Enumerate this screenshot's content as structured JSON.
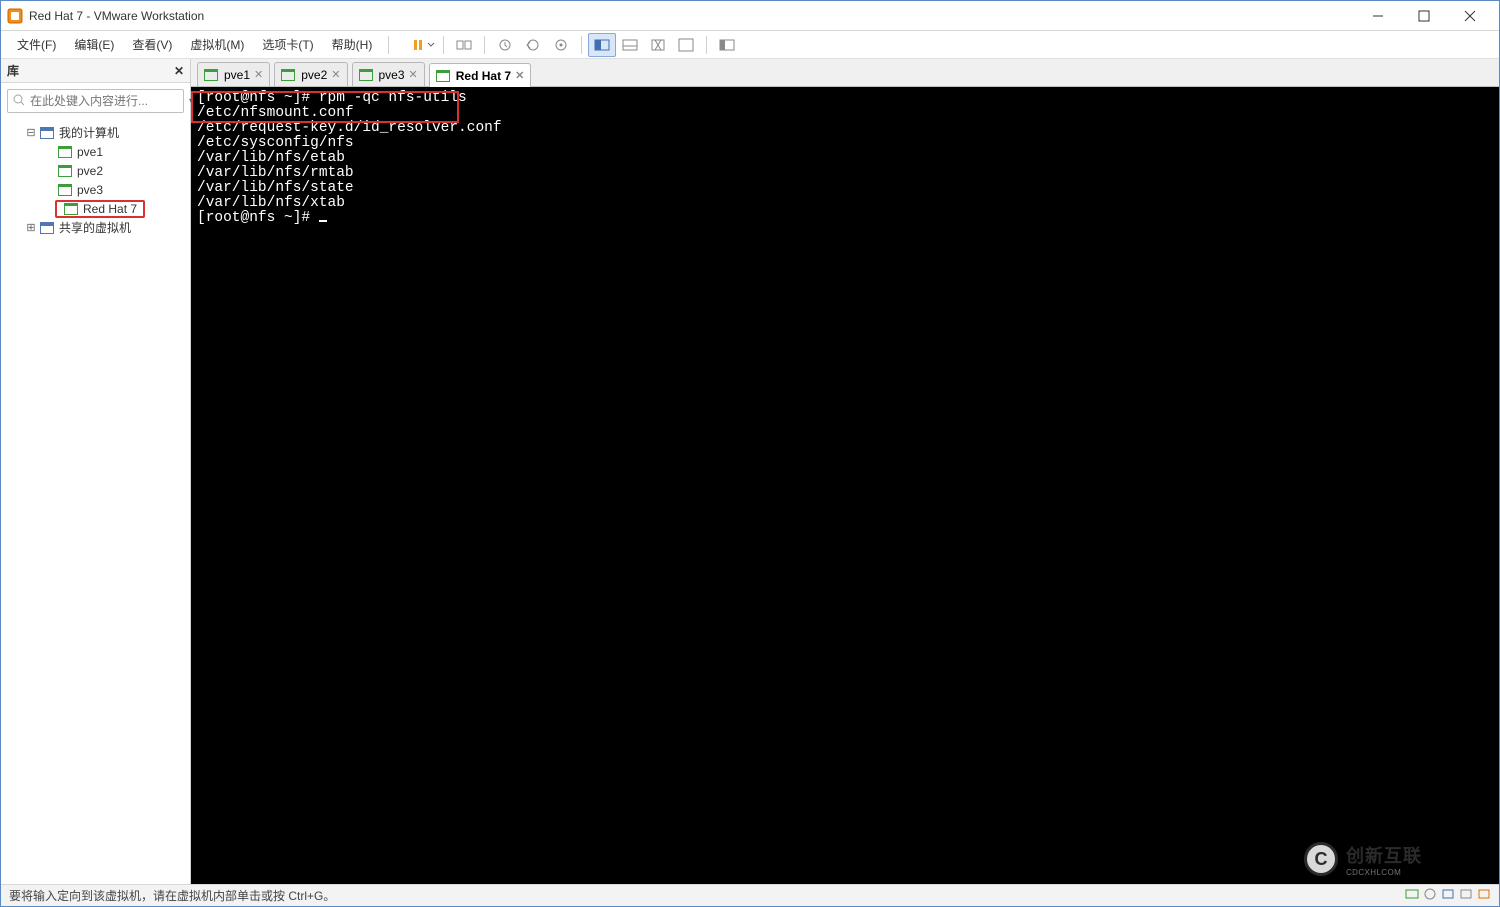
{
  "titlebar": {
    "title": "Red Hat 7 - VMware Workstation"
  },
  "menu": {
    "file": "文件(F)",
    "edit": "编辑(E)",
    "view": "查看(V)",
    "vm": "虚拟机(M)",
    "tabs": "选项卡(T)",
    "help": "帮助(H)"
  },
  "sidebar": {
    "title": "库",
    "search_placeholder": "在此处键入内容进行...",
    "root": "我的计算机",
    "items": [
      "pve1",
      "pve2",
      "pve3",
      "Red Hat 7"
    ],
    "shared": "共享的虚拟机"
  },
  "tabs": [
    {
      "label": "pve1",
      "active": false
    },
    {
      "label": "pve2",
      "active": false
    },
    {
      "label": "pve3",
      "active": false
    },
    {
      "label": "Red Hat 7",
      "active": true
    }
  ],
  "terminal": {
    "lines": [
      "[root@nfs ~]# rpm -qc nfs-utils",
      "/etc/nfsmount.conf",
      "/etc/request-key.d/id_resolver.conf",
      "/etc/sysconfig/nfs",
      "/var/lib/nfs/etab",
      "/var/lib/nfs/rmtab",
      "/var/lib/nfs/state",
      "/var/lib/nfs/xtab",
      "[root@nfs ~]# "
    ]
  },
  "statusbar": {
    "msg": "要将输入定向到该虚拟机，请在虚拟机内部单击或按 Ctrl+G。"
  },
  "watermark": {
    "brand": "创新互联",
    "sub": "CDCXHLCOM"
  }
}
